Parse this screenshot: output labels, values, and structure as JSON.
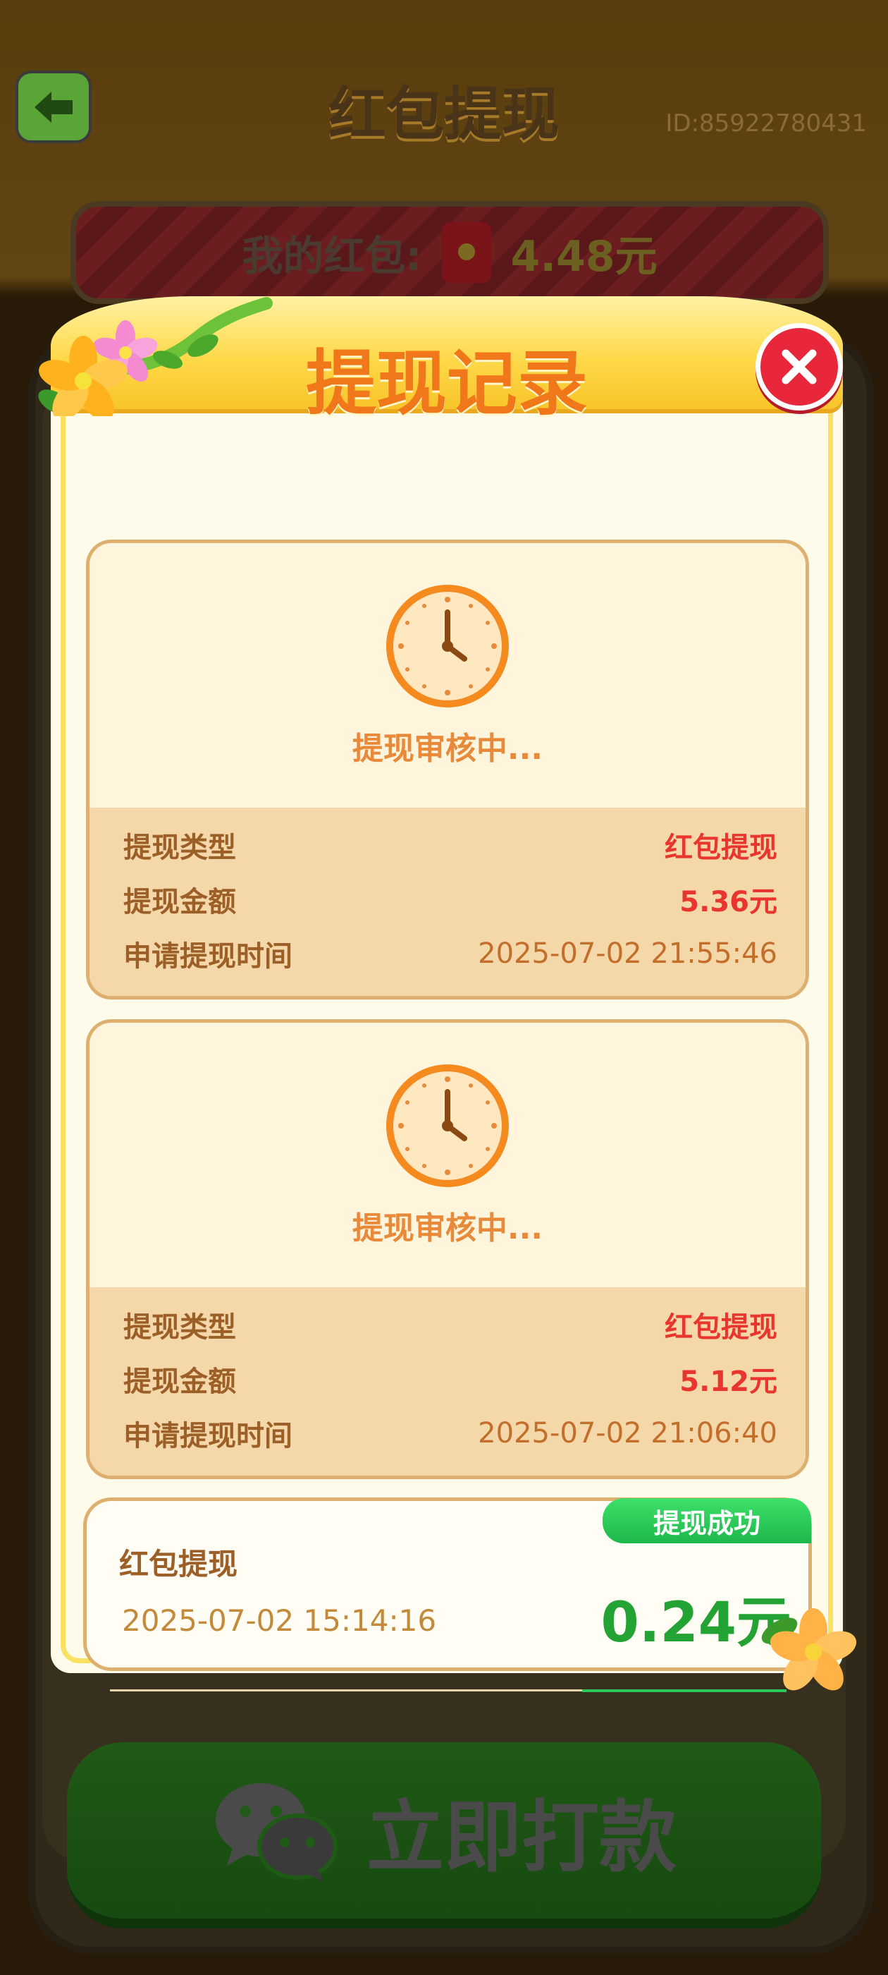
{
  "page": {
    "title": "红包提现",
    "user_id": "ID:85922780431",
    "balance_label": "我的红包:",
    "balance_value": "4.48元",
    "pay_button_label": "立即打款"
  },
  "modal": {
    "title": "提现记录",
    "pending_records": [
      {
        "status": "提现审核中...",
        "type_label": "提现类型",
        "type_value": "红包提现",
        "amount_label": "提现金额",
        "amount_value": "5.36元",
        "time_label": "申请提现时间",
        "time_value": "2025-07-02 21:55:46"
      },
      {
        "status": "提现审核中...",
        "type_label": "提现类型",
        "type_value": "红包提现",
        "amount_label": "提现金额",
        "amount_value": "5.12元",
        "time_label": "申请提现时间",
        "time_value": "2025-07-02 21:06:40"
      }
    ],
    "completed_records": [
      {
        "badge": "提现成功",
        "type": "红包提现",
        "time": "2025-07-02 15:14:16",
        "amount": "0.24元"
      }
    ]
  },
  "colors": {
    "accent_orange": "#f0781a",
    "success_green": "#23a334",
    "alert_red": "#e8362e"
  },
  "icons": [
    "back-arrow-icon",
    "red-envelope-icon",
    "close-icon",
    "clock-icon",
    "wechat-icon",
    "flower-icon"
  ]
}
